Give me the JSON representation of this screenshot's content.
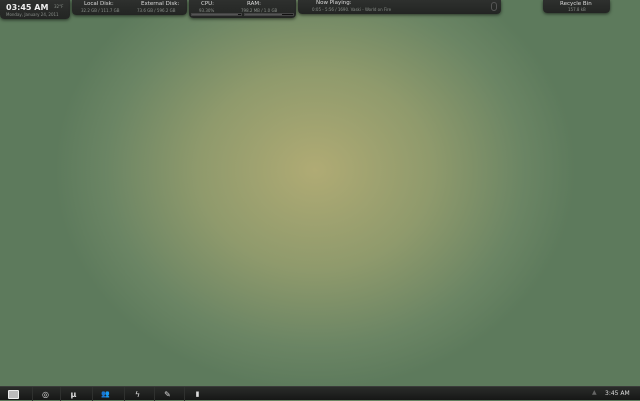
{
  "clock": {
    "time": "03:45 AM",
    "temp": "32°F",
    "date": "Monday, January 24, 2011"
  },
  "disks": {
    "local_label": "Local Disk:",
    "local_value": "32.2 GB / 111.7 GB",
    "external_label": "External Disk:",
    "external_value": "73.6 GB / 596.2 GB"
  },
  "system": {
    "cpu_label": "CPU:",
    "cpu_value": "93.30%",
    "cpu_fraction": 0.93,
    "ram_label": "RAM:",
    "ram_value": "798.2 MB / 1.0 GB",
    "ram_fraction": 0.78
  },
  "now_playing": {
    "label": "Now Playing:",
    "track": "0:05 - 5:56 / 1690. Vaski - World on Fire"
  },
  "recycle_bin": {
    "label": "Recycle Bin",
    "size": "157.8 kB"
  },
  "taskbar": {
    "clock": "3:45 AM"
  }
}
